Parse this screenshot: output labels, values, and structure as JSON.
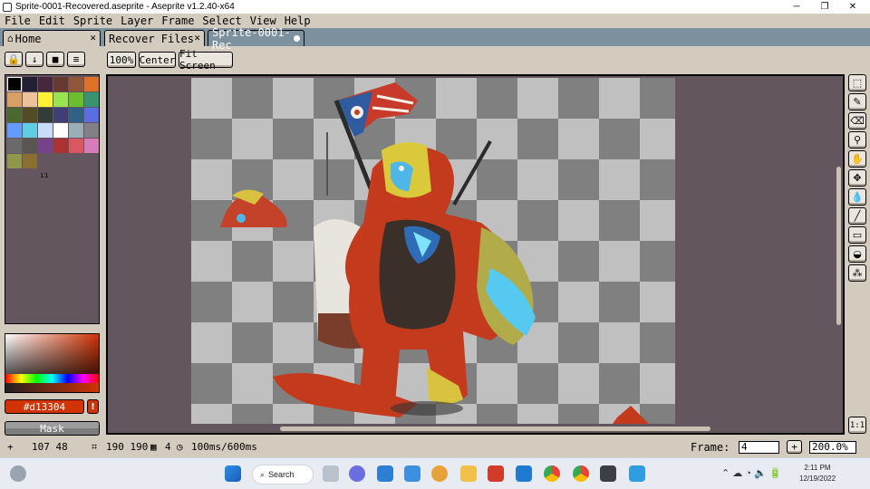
{
  "window": {
    "title": "Sprite-0001-Recovered.aseprite - Aseprite v1.2.40-x64",
    "minimize": "─",
    "maximize": "❐",
    "close": "✕"
  },
  "menu": [
    "File",
    "Edit",
    "Sprite",
    "Layer",
    "Frame",
    "Select",
    "View",
    "Help"
  ],
  "tabs": [
    {
      "label": "Home",
      "icon": "home-icon",
      "close": "✕"
    },
    {
      "label": "Recover Files",
      "close": "✕"
    },
    {
      "label": "Sprite-0001-Rec",
      "modified": true
    }
  ],
  "palette_toolbar": {
    "lock": "🔒",
    "options": "↓",
    "save": "■",
    "menu": "≡"
  },
  "view_buttons": {
    "zoom100": "100%",
    "center": "Center",
    "fit": "Fit Screen"
  },
  "palette": {
    "colors": [
      "#000000",
      "#222034",
      "#45283c",
      "#663931",
      "#8f563b",
      "#df7126",
      "#d9a066",
      "#eec39a",
      "#fbf236",
      "#99e550",
      "#6abe30",
      "#37946e",
      "#4b692f",
      "#524b24",
      "#323c39",
      "#3f3f74",
      "#306082",
      "#5b6ee1",
      "#639bff",
      "#5fcde4",
      "#cbdbfc",
      "#ffffff",
      "#9badb7",
      "#847e87",
      "#696a6a",
      "#595652",
      "#76428a",
      "#ac3232",
      "#d95763",
      "#d77bba",
      "#8f974a",
      "#8a6f30"
    ],
    "selected_index": 0,
    "resize_handle": "ıı"
  },
  "color": {
    "hex": "#d13304",
    "label": "#d13304",
    "warning": "!"
  },
  "mask_label": "Mask",
  "tools": [
    {
      "name": "marquee-icon",
      "glyph": "⬚"
    },
    {
      "name": "pencil-icon",
      "glyph": "✎"
    },
    {
      "name": "eraser-icon",
      "glyph": "⌫"
    },
    {
      "name": "eyedropper-icon",
      "glyph": "⚲"
    },
    {
      "name": "hand-icon",
      "glyph": "✋"
    },
    {
      "name": "move-icon",
      "glyph": "✥"
    },
    {
      "name": "fill-icon",
      "glyph": "💧"
    },
    {
      "name": "line-icon",
      "glyph": "╱"
    },
    {
      "name": "rectangle-icon",
      "glyph": "▭"
    },
    {
      "name": "contour-icon",
      "glyph": "◒"
    },
    {
      "name": "spray-icon",
      "glyph": "⁂"
    }
  ],
  "one_to_one": "1:1",
  "status": {
    "pos_icon": "+",
    "pos": "107 48",
    "size_icon": "⌗",
    "size": "190 190",
    "frame_icon": "▦",
    "frame_count": "4",
    "time_icon": "◷",
    "duration": "100ms/600ms",
    "frame_label": "Frame:",
    "frame_value": "4",
    "add_frame": "+",
    "zoom": "200.0%"
  },
  "taskbar": {
    "search": "Search",
    "time": "2:11 PM",
    "date": "12/19/2022",
    "tray": "⌃  ☁  ◔  🔈  🔋"
  }
}
